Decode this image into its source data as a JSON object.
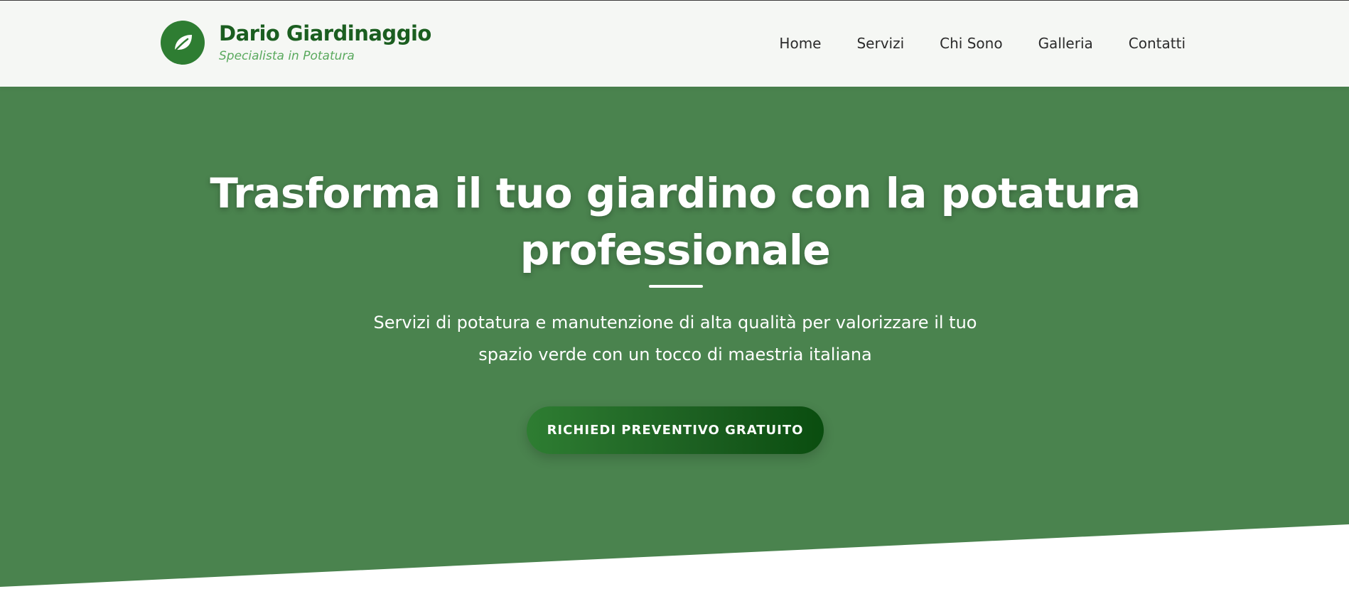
{
  "brand": {
    "name": "Dario Giardinaggio",
    "tagline": "Specialista in Potatura",
    "logo_icon": "leaf-icon"
  },
  "nav": {
    "items": [
      {
        "label": "Home"
      },
      {
        "label": "Servizi"
      },
      {
        "label": "Chi Sono"
      },
      {
        "label": "Galleria"
      },
      {
        "label": "Contatti"
      }
    ]
  },
  "hero": {
    "title": "Trasforma il tuo giardino con la potatura professionale",
    "subtitle": "Servizi di potatura e manutenzione di alta qualità per valorizzare il tuo spazio verde con un tocco di maestria italiana",
    "cta_label": "RICHIEDI PREVENTIVO GRATUITO"
  },
  "colors": {
    "header_bg": "#f5f7f4",
    "brand_green": "#1b5e20",
    "logo_green": "#2e7d32",
    "tagline_green": "#5aa95e",
    "hero_bg": "#4a834e",
    "cta_gradient_start": "#2e7d32",
    "cta_gradient_end": "#0a4d0f"
  }
}
